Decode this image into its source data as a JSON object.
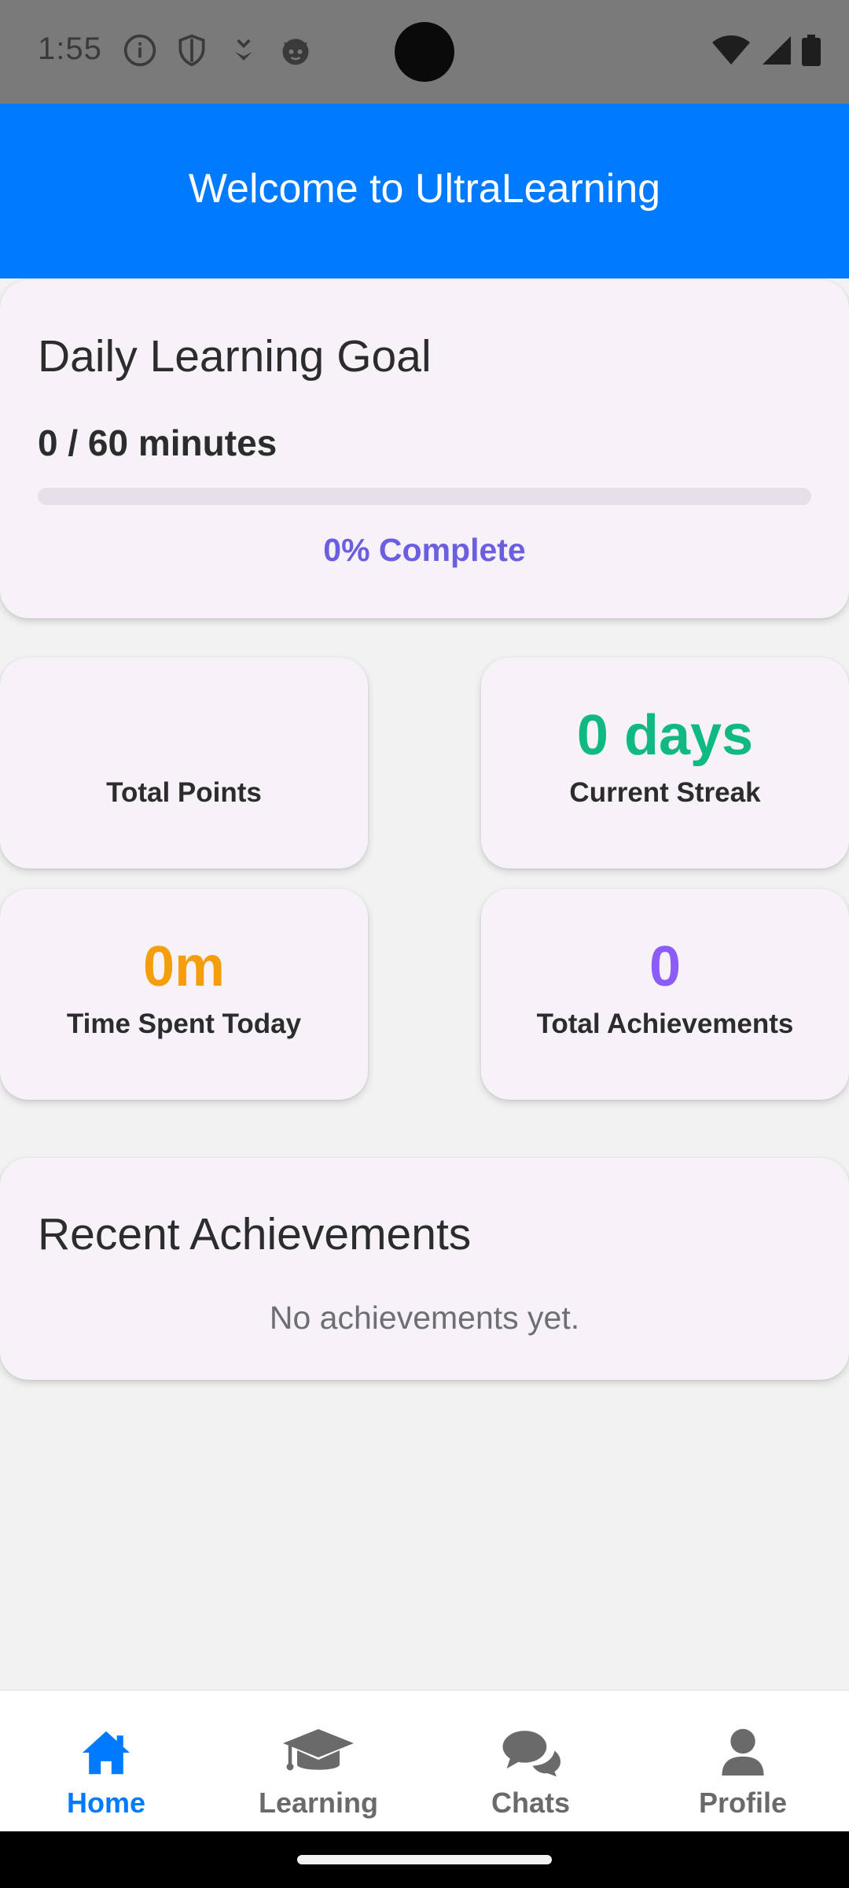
{
  "status_bar": {
    "time": "1:55",
    "left_icons": [
      "info-icon",
      "shield-icon",
      "download-icon",
      "cat-icon"
    ],
    "right_icons": [
      "wifi-icon",
      "signal-icon",
      "battery-icon"
    ]
  },
  "header": {
    "title": "Welcome to UltraLearning",
    "color": "#007aff"
  },
  "daily_goal": {
    "title": "Daily Learning Goal",
    "minutes_text": "0 / 60 minutes",
    "progress": 0,
    "percent_text": "0% Complete"
  },
  "stats": [
    {
      "value": "",
      "label": "Total Points",
      "color": "#2c2c2e"
    },
    {
      "value": "0 days",
      "label": "Current Streak",
      "color": "#10b981"
    },
    {
      "value": "0m",
      "label": "Time Spent Today",
      "color": "#f59e0b"
    },
    {
      "value": "0",
      "label": "Total Achievements",
      "color": "#8b5cf6"
    }
  ],
  "recent_achievements": {
    "title": "Recent Achievements",
    "empty_text": "No achievements yet."
  },
  "nav": {
    "active": "home",
    "items": [
      {
        "label": "Home",
        "icon": "home-icon"
      },
      {
        "label": "Learning",
        "icon": "graduation-cap-icon"
      },
      {
        "label": "Chats",
        "icon": "chat-bubbles-icon"
      },
      {
        "label": "Profile",
        "icon": "user-icon"
      }
    ]
  }
}
